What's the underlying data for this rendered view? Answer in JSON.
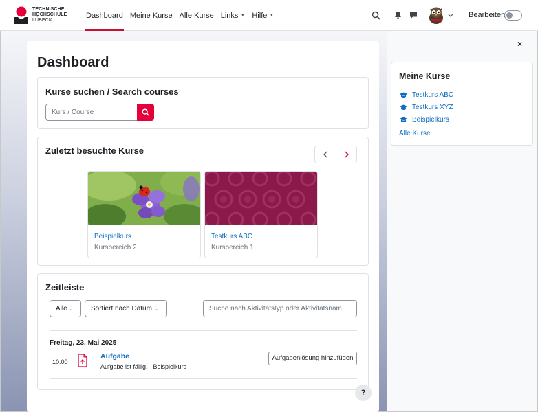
{
  "brand": {
    "line1": "TECHNISCHE",
    "line2": "HOCHSCHULE",
    "line3": "LÜBECK",
    "accent": "#c8102e"
  },
  "nav": {
    "items": [
      {
        "label": "Dashboard",
        "active": true
      },
      {
        "label": "Meine Kurse"
      },
      {
        "label": "Alle Kurse"
      },
      {
        "label": "Links",
        "dropdown": true
      },
      {
        "label": "Hilfe",
        "dropdown": true
      }
    ],
    "edit_label": "Bearbeiten",
    "icons": [
      "search-icon",
      "bell-icon",
      "chat-icon",
      "avatar",
      "chevron-down-icon"
    ]
  },
  "page": {
    "title": "Dashboard"
  },
  "search_block": {
    "title": "Kurse suchen / Search courses",
    "placeholder": "Kurs / Course"
  },
  "recent": {
    "title": "Zuletzt besuchte Kurse",
    "courses": [
      {
        "name": "Beispielkurs",
        "category": "Kursbereich 2"
      },
      {
        "name": "Testkurs ABC",
        "category": "Kursbereich 1"
      }
    ]
  },
  "timeline": {
    "title": "Zeitleiste",
    "filter": "Alle",
    "sort": "Sortiert nach Datum",
    "search_placeholder": "Suche nach Aktivitätstyp oder Aktivitätsnam",
    "date": "Freitag, 23. Mai 2025",
    "event": {
      "time": "10:00",
      "name": "Aufgabe",
      "subtitle": "Aufgabe ist fällig. · Beispielkurs",
      "action": "Aufgabenlösung hinzufügen"
    }
  },
  "help": {
    "label": "?"
  },
  "drawer": {
    "close": "×",
    "block_title": "Meine Kurse",
    "courses": [
      "Testkurs ABC",
      "Testkurs XYZ",
      "Beispielkurs"
    ],
    "all_link": "Alle Kurse ..."
  },
  "colors": {
    "link": "#0f6cbf",
    "primary_red": "#e4003a",
    "border": "#dee2e6"
  }
}
